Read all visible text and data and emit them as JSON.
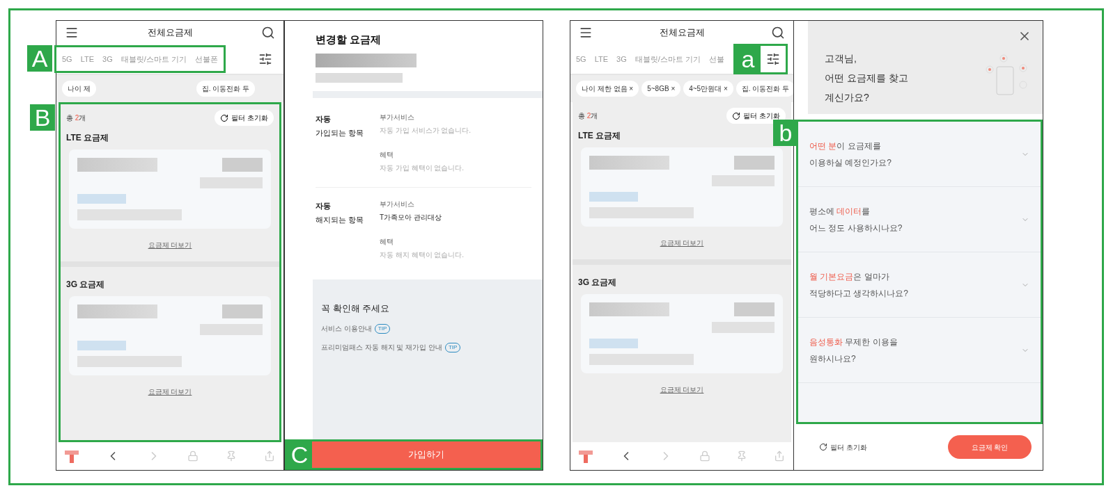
{
  "screens": [
    {
      "kind": "list",
      "title": "전체요금제",
      "tabs_marker": "A",
      "list_marker": "B",
      "tabs": [
        {
          "label": "5G"
        },
        {
          "label": "LTE"
        },
        {
          "label": "3G"
        },
        {
          "label": "태블릿/스마트 기기"
        },
        {
          "label": "선불폰"
        }
      ],
      "chips": [
        {
          "label": "나이 제"
        },
        {
          "label": "집. 이동전화 두"
        }
      ],
      "count": {
        "prefix": "총",
        "number": "2",
        "suffix": "개"
      },
      "reset": "필터 초기화",
      "sections": [
        {
          "title": "LTE 요금제",
          "more": "요금제 더보기"
        },
        {
          "title": "3G 요금제",
          "more": "요금제 더보기"
        }
      ]
    },
    {
      "kind": "detail",
      "title": "변경할 요금제",
      "groups": [
        {
          "label_top": "자동",
          "label": "가입되는 항목",
          "items": [
            {
              "heading": "부가서비스",
              "value": "자동 가입 서비스가 없습니다.",
              "empty": true
            },
            {
              "heading": "혜택",
              "value": "자동 가입 혜택이 없습니다.",
              "empty": true
            }
          ]
        },
        {
          "label_top": "자동",
          "label": "해지되는 항목",
          "items": [
            {
              "heading": "부가서비스",
              "value": "T가족모아 관리대상",
              "empty": false
            },
            {
              "heading": "혜택",
              "value": "자동 해지 혜택이 없습니다.",
              "empty": true
            }
          ]
        }
      ],
      "notice": {
        "title": "꼭 확인해 주세요",
        "links": [
          {
            "text": "서비스 이용안내",
            "badge": "TIP"
          },
          {
            "text": "프리미엄패스 자동 해지 및 재가입 안내",
            "badge": "TIP"
          }
        ]
      },
      "button": {
        "label": "가입하기",
        "marker": "C"
      }
    },
    {
      "kind": "list",
      "title": "전체요금제",
      "filter_marker": "a",
      "tabs": [
        {
          "label": "5G"
        },
        {
          "label": "LTE"
        },
        {
          "label": "3G"
        },
        {
          "label": "태블릿/스마트 기기"
        },
        {
          "label": "선불"
        }
      ],
      "chips": [
        {
          "label": "나이 제한 없음 ×"
        },
        {
          "label": "5~8GB ×"
        },
        {
          "label": "4~5만원대 ×"
        },
        {
          "label": "집. 이동전화 두"
        }
      ],
      "count": {
        "prefix": "총",
        "number": "2",
        "suffix": "개"
      },
      "reset": "필터 초기화",
      "sections": [
        {
          "title": "LTE 요금제",
          "more": "요금제 더보기"
        },
        {
          "title": "3G 요금제",
          "more": "요금제 더보기"
        }
      ]
    },
    {
      "kind": "finder",
      "greeting": [
        "고객님,",
        "어떤 요금제를 찾고",
        "계신가요?"
      ],
      "questions_marker": "b",
      "questions": [
        {
          "lines": [
            [
              {
                "text": "어떤 분",
                "highlight": true
              },
              {
                "text": "이 요금제를",
                "highlight": false
              }
            ],
            [
              {
                "text": "이용하실 예정인가요?",
                "highlight": false
              }
            ]
          ]
        },
        {
          "lines": [
            [
              {
                "text": "평소에 ",
                "highlight": false
              },
              {
                "text": "데이터",
                "highlight": true
              },
              {
                "text": "를",
                "highlight": false
              }
            ],
            [
              {
                "text": "어느 정도 사용하시나요?",
                "highlight": false
              }
            ]
          ]
        },
        {
          "lines": [
            [
              {
                "text": "월 기본요금",
                "highlight": true
              },
              {
                "text": "은 얼마가",
                "highlight": false
              }
            ],
            [
              {
                "text": "적당하다고 생각하시나요?",
                "highlight": false
              }
            ]
          ]
        },
        {
          "lines": [
            [
              {
                "text": "음성통화",
                "highlight": true
              },
              {
                "text": " 무제한 이용을",
                "highlight": false
              }
            ],
            [
              {
                "text": "원하시나요?",
                "highlight": false
              }
            ]
          ]
        }
      ],
      "reset": "필터 초기화",
      "confirm": "요금제 확인"
    }
  ]
}
